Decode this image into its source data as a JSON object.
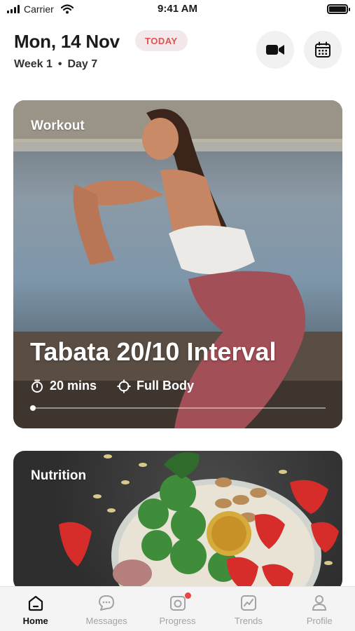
{
  "status_bar": {
    "carrier": "Carrier",
    "time": "9:41 AM"
  },
  "header": {
    "date": "Mon, 14 Nov",
    "today_badge": "TODAY",
    "week": "Week 1",
    "separator": "•",
    "day": "Day 7",
    "video_button_icon": "video-camera-icon",
    "calendar_button_icon": "calendar-icon"
  },
  "workout_card": {
    "label": "Workout",
    "title": "Tabata 20/10 Interval",
    "duration": "20 mins",
    "focus": "Full Body",
    "progress": 0.0
  },
  "nutrition_card": {
    "label": "Nutrition"
  },
  "tab_bar": {
    "items": [
      {
        "label": "Home",
        "icon": "home-icon",
        "active": true
      },
      {
        "label": "Messages",
        "icon": "chat-bubble-icon",
        "active": false
      },
      {
        "label": "Progress",
        "icon": "camera-icon",
        "active": false,
        "badge": true
      },
      {
        "label": "Trends",
        "icon": "trend-chart-icon",
        "active": false
      },
      {
        "label": "Profile",
        "icon": "person-icon",
        "active": false
      }
    ]
  },
  "colors": {
    "accent_red": "#e0514e",
    "today_bg": "#f3e9ea",
    "tab_inactive": "#a3a3a3"
  }
}
